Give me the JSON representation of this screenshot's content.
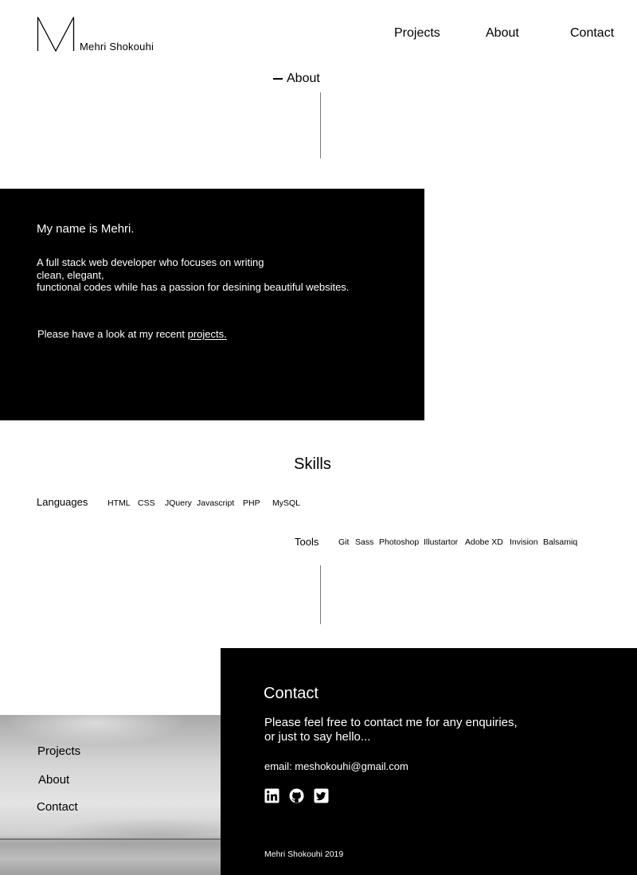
{
  "header": {
    "logo_letter": "M",
    "site_name": "Mehri Shokouhi",
    "nav": [
      "Projects",
      "About",
      "Contact"
    ]
  },
  "about": {
    "heading": "About",
    "greeting": "My name is Mehri.",
    "bio_lines": [
      "A full stack  web developer who focuses on writing",
      "clean, elegant,",
      "functional codes while has a passion for desining beautiful websites."
    ],
    "cta_text": "Please have a look at my recent ",
    "cta_link": "projects."
  },
  "skills": {
    "title": "Skills",
    "languages_label": "Languages",
    "languages": [
      "HTML",
      "CSS",
      "JQuery",
      "Javascript",
      "PHP",
      "MySQL"
    ],
    "tools_label": "Tools",
    "tools": [
      "Git",
      "Sass",
      "Photoshop",
      "Illustartor",
      "Adobe XD",
      "Invision",
      "Balsamiq"
    ]
  },
  "footer": {
    "nav": [
      "Projects",
      "About",
      "Contact"
    ],
    "contact_title": "Contact",
    "message_lines": [
      "Please feel free to contact me for  any enquiries,",
      "or just to say hello..."
    ],
    "email": "email: meshokouhi@gmail.com",
    "social_icons": [
      "linkedin-icon",
      "github-icon",
      "twitter-icon"
    ],
    "copyright": "Mehri Shokouhi 2019"
  },
  "colors": {
    "background": "#ffffff",
    "panel": "#000000",
    "text_on_panel": "#ffffff",
    "divider": "#777777"
  }
}
